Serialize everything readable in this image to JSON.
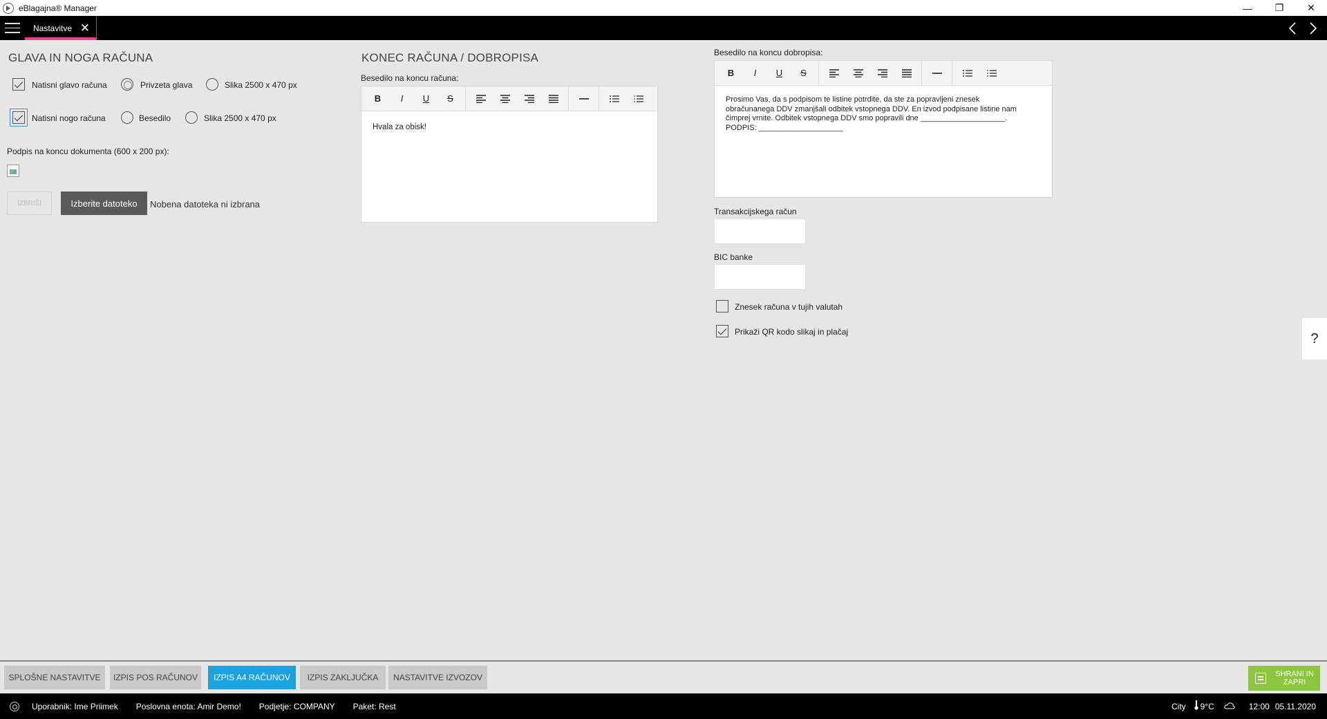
{
  "window": {
    "title": "eBlagajna® Manager",
    "minimize": "—",
    "restore": "❐",
    "close": "✕"
  },
  "tabs": [
    {
      "label": "Nastavitve",
      "close": "✕"
    }
  ],
  "head_foot": {
    "title": "GLAVA IN NOGA RAČUNA",
    "print_header": {
      "label": "Natisni glavo računa",
      "checked": true
    },
    "header_default": "Privzeta glava",
    "header_image": "Slika 2500 x 470 px",
    "print_footer": {
      "label": "Natisni nogo računa",
      "checked": true
    },
    "footer_text": "Besedilo",
    "footer_image": "Slika 2500 x 470 px",
    "signature_label": "Podpis na koncu dokumenta (600 x 200 px):",
    "delete_button": "IZBRIŠI",
    "choose_file_button": "Izberite datoteko",
    "no_file_text": "Nobena datoteka ni izbrana"
  },
  "invoice_end": {
    "title": "KONEC RAČUNA / DOBROPISA",
    "invoice_text_label": "Besedilo na koncu računa:",
    "invoice_text": "Hvala za obisk!",
    "credit_text_label": "Besedilo na koncu dobropisa:",
    "credit_text": "Prosimo Vas, da s podpisom te listine potrdite, da ste za popravljeni znesek\nobračunanega DDV zmanjšali odbitek vstopnega DDV. En izvod podpisane listine nam\nčimprej vrnite. Odbitek vstopnega DDV smo popravili dne ____________________.\nPODPIS: ____________________"
  },
  "toolbar": {
    "bold": "B",
    "italic": "I",
    "underline": "U",
    "strike": "S"
  },
  "bank": {
    "transaction_label": "Transakcijskega račun",
    "transaction_value": "",
    "bic_label": "BIC banke",
    "bic_value": "",
    "foreign_currency": {
      "label": "Znesek računa v tujih valutah",
      "checked": false
    },
    "qr_code": {
      "label": "Prikaži QR kodo slikaj in plačaj",
      "checked": true
    }
  },
  "help": "?",
  "bottom_tabs": [
    {
      "label": "SPLOŠNE NASTAVITVE",
      "active": false
    },
    {
      "label": "IZPIS POS RAČUNOV",
      "active": false
    },
    {
      "label": "IZPIS A4 RAČUNOV",
      "active": true
    },
    {
      "label": "IZPIS ZAKLJUČKA",
      "active": false
    },
    {
      "label": "NASTAVITVE IZVOZOV",
      "active": false
    }
  ],
  "save_button": "SHRANI IN ZAPRI",
  "status": {
    "user": "Uporabnik: Ime Priimek",
    "unit": "Poslovna enota: Amir Demo!",
    "company": "Podjetje: COMPANY",
    "package": "Paket: Rest",
    "city": "City",
    "temperature": "9°C",
    "time": "12:00",
    "date": "05.11.2020"
  }
}
